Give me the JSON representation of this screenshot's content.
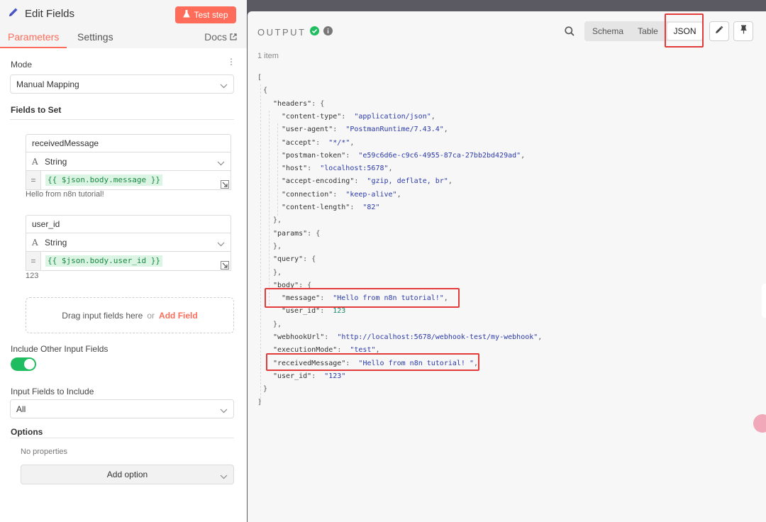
{
  "left": {
    "title": "Edit Fields",
    "test_step_label": "Test step",
    "tabs": [
      "Parameters",
      "Settings"
    ],
    "docs_label": "Docs",
    "mode_label": "Mode",
    "mode_value": "Manual Mapping",
    "fields_to_set_label": "Fields to Set",
    "fields": [
      {
        "name": "receivedMessage",
        "type": "String",
        "expression": "{{ $json.body.message }}",
        "result": "Hello from n8n tutorial!"
      },
      {
        "name": "user_id",
        "type": "String",
        "expression": "{{ $json.body.user_id }}",
        "result": "123"
      }
    ],
    "equals_sign": "=",
    "dropzone_text": "Drag input fields here",
    "dropzone_or": "or",
    "add_field_label": "Add Field",
    "include_other_label": "Include Other Input Fields",
    "include_other_enabled": true,
    "input_fields_include_label": "Input Fields to Include",
    "input_fields_include_value": "All",
    "options_label": "Options",
    "no_properties_text": "No properties",
    "add_option_label": "Add option"
  },
  "right": {
    "output_label": "OUTPUT",
    "items_count": "1 item",
    "views": [
      "Schema",
      "Table",
      "JSON"
    ],
    "active_view": "JSON",
    "json_lines": [
      {
        "text": "[",
        "cls": "p"
      },
      {
        "text": "{",
        "cls": "p"
      },
      {
        "key": "\"headers\"",
        "punct": ": {"
      },
      {
        "key": "\"content-type\"",
        "value": "\"application/json\"",
        "vcls": "s",
        "tail": ","
      },
      {
        "key": "\"user-agent\"",
        "value": "\"PostmanRuntime/7.43.4\"",
        "vcls": "s",
        "tail": ","
      },
      {
        "key": "\"accept\"",
        "value": "\"*/*\"",
        "vcls": "s",
        "tail": ","
      },
      {
        "key": "\"postman-token\"",
        "value": "\"e59c6d6e-c9c6-4955-87ca-27bb2bd429ad\"",
        "vcls": "s",
        "tail": ","
      },
      {
        "key": "\"host\"",
        "value": "\"localhost:5678\"",
        "vcls": "s",
        "tail": ","
      },
      {
        "key": "\"accept-encoding\"",
        "value": "\"gzip, deflate, br\"",
        "vcls": "s",
        "tail": ","
      },
      {
        "key": "\"connection\"",
        "value": "\"keep-alive\"",
        "vcls": "s",
        "tail": ","
      },
      {
        "key": "\"content-length\"",
        "value": "\"82\"",
        "vcls": "s",
        "tail": ""
      },
      {
        "text": "},",
        "cls": "p"
      },
      {
        "key": "\"params\"",
        "punct": ": {"
      },
      {
        "text": "},",
        "cls": "p"
      },
      {
        "key": "\"query\"",
        "punct": ": {"
      },
      {
        "text": "},",
        "cls": "p"
      },
      {
        "key": "\"body\"",
        "punct": ": {"
      },
      {
        "key": "\"message\"",
        "value": "\"Hello from n8n tutorial!\"",
        "vcls": "s",
        "tail": ","
      },
      {
        "key": "\"user_id\"",
        "value": "123",
        "vcls": "n",
        "tail": ""
      },
      {
        "text": "},",
        "cls": "p"
      },
      {
        "key": "\"webhookUrl\"",
        "value": "\"http://localhost:5678/webhook-test/my-webhook\"",
        "vcls": "s",
        "tail": ","
      },
      {
        "key": "\"executionMode\"",
        "value": "\"test\"",
        "vcls": "s",
        "tail": ","
      },
      {
        "key": "\"receivedMessage\"",
        "value": "\"Hello from n8n tutorial! \"",
        "vcls": "s",
        "tail": ","
      },
      {
        "key": "\"user_id\"",
        "value": "\"123\"",
        "vcls": "s",
        "tail": ""
      },
      {
        "text": "}",
        "cls": "p"
      },
      {
        "text": "]",
        "cls": "p"
      }
    ]
  },
  "colors": {
    "accent": "#ff6d5a",
    "toggle_on": "#1fbd5f",
    "json_string": "#2b3aa8",
    "json_number": "#13896b",
    "highlight_red": "#e33a3a"
  }
}
